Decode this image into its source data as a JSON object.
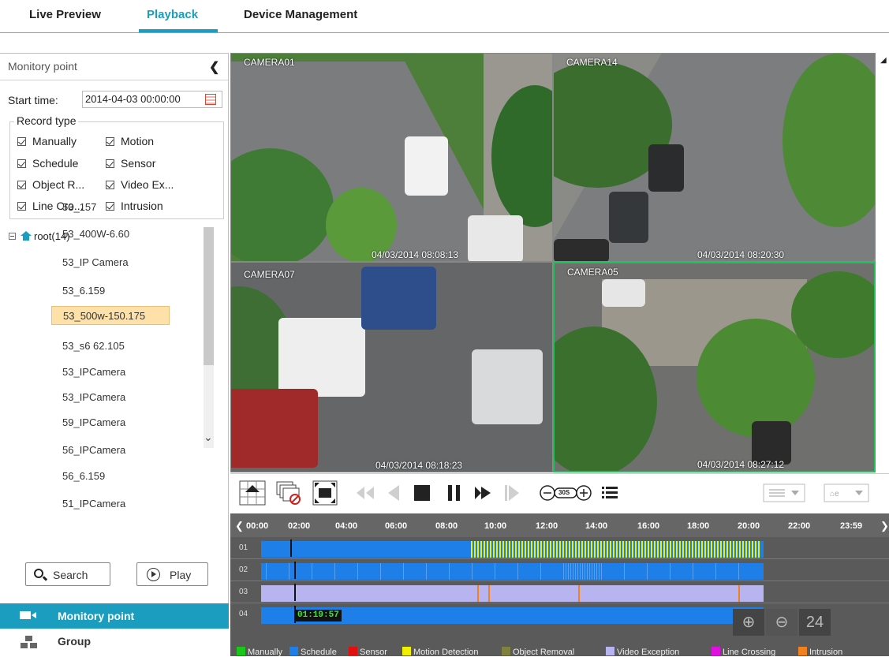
{
  "nav": {
    "tabs": [
      {
        "label": "Live Preview",
        "active": false
      },
      {
        "label": "Playback",
        "active": true
      },
      {
        "label": "Device Management",
        "active": false
      }
    ]
  },
  "sidebar": {
    "title": "Monitory point",
    "start_label": "Start time:",
    "start_value": "2014-04-03 00:00:00",
    "record_type_label": "Record type",
    "record_types": [
      {
        "label": "Manually",
        "checked": true
      },
      {
        "label": "Motion",
        "checked": true
      },
      {
        "label": "Schedule",
        "checked": true
      },
      {
        "label": "Sensor",
        "checked": true
      },
      {
        "label": "Object R...",
        "checked": true
      },
      {
        "label": "Video Ex...",
        "checked": true
      },
      {
        "label": "Line Cro...",
        "checked": true
      },
      {
        "label": "Intrusion",
        "checked": true
      }
    ],
    "tree_root": "root(14)",
    "tree_items": [
      "53_157",
      "53_400W-6.60",
      "53_IP Camera",
      "53_6.159",
      "53_500w-150.175",
      "53_s6 62.105",
      "53_IPCamera",
      "53_IPCamera",
      "59_IPCamera",
      "56_IPCamera",
      "56_6.159",
      "51_IPCamera"
    ],
    "selected_item": "53_500w-150.175",
    "search_label": "Search",
    "play_label": "Play",
    "bottom_nav": [
      {
        "label": "Monitory point",
        "active": true
      },
      {
        "label": "Group",
        "active": false
      }
    ]
  },
  "cameras": [
    {
      "name": "CAMERA01",
      "timestamp": "04/03/2014  08:08:13",
      "active": false
    },
    {
      "name": "CAMERA14",
      "timestamp": "04/03/2014  08:20:30",
      "active": false
    },
    {
      "name": "CAMERA07",
      "timestamp": "04/03/2014  08:18:23",
      "active": false
    },
    {
      "name": "CAMERA05",
      "timestamp": "04/03/2014  08:27:12",
      "active": true
    }
  ],
  "controls": {
    "speed_label": "30S"
  },
  "timeline": {
    "ticks": [
      "00:00",
      "02:00",
      "04:00",
      "06:00",
      "08:00",
      "10:00",
      "12:00",
      "14:00",
      "16:00",
      "18:00",
      "20:00",
      "22:00",
      "23:59"
    ],
    "rows": [
      "01",
      "02",
      "03",
      "04"
    ],
    "current_time": "01:19:57",
    "zoom_value": "24",
    "legend": [
      {
        "label": "Manually",
        "color": "#19c619"
      },
      {
        "label": "Schedule",
        "color": "#1e7fe8"
      },
      {
        "label": "Sensor",
        "color": "#e01010"
      },
      {
        "label": "Motion Detection",
        "color": "#f0f000"
      },
      {
        "label": "Object Removal",
        "color": "#808040"
      },
      {
        "label": "Video Exception",
        "color": "#b8b4f0"
      },
      {
        "label": "Line Crossing",
        "color": "#e010e0"
      },
      {
        "label": "Intrusion",
        "color": "#f08020"
      }
    ]
  }
}
